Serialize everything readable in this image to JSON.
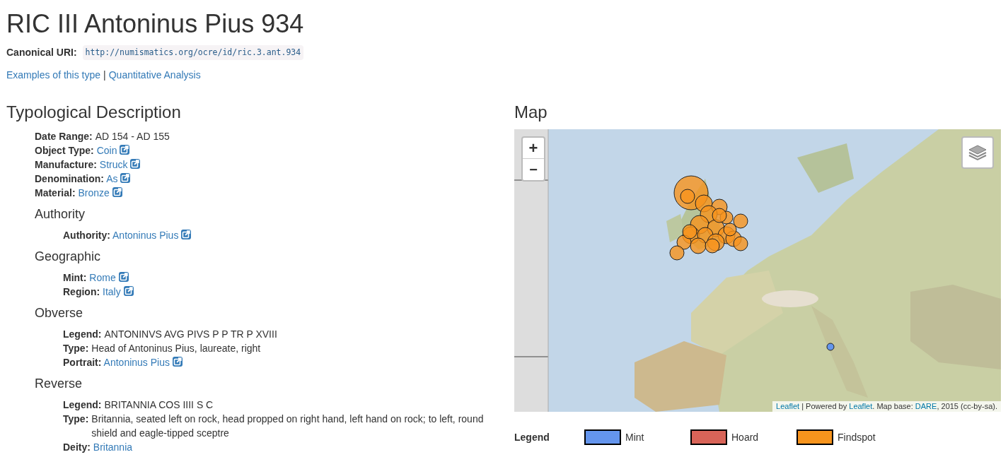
{
  "title": "RIC III Antoninus Pius 934",
  "canonical": {
    "label": "Canonical URI:",
    "uri": "http://numismatics.org/ocre/id/ric.3.ant.934"
  },
  "links": [
    {
      "label": "Examples of this type"
    },
    {
      "label": "Quantitative Analysis"
    }
  ],
  "link_separator": "|",
  "description": {
    "heading": "Typological Description",
    "fields": [
      {
        "label": "Date Range:",
        "value": "AD 154 - AD 155",
        "kind": "text"
      },
      {
        "label": "Object Type:",
        "value": "Coin",
        "kind": "external"
      },
      {
        "label": "Manufacture:",
        "value": "Struck",
        "kind": "external"
      },
      {
        "label": "Denomination:",
        "value": "As",
        "kind": "external"
      },
      {
        "label": "Material:",
        "value": "Bronze",
        "kind": "external"
      }
    ],
    "sections": [
      {
        "heading": "Authority",
        "fields": [
          {
            "label": "Authority:",
            "value": "Antoninus Pius",
            "kind": "external"
          }
        ]
      },
      {
        "heading": "Geographic",
        "fields": [
          {
            "label": "Mint:",
            "value": "Rome",
            "kind": "external"
          },
          {
            "label": "Region:",
            "value": "Italy",
            "kind": "external"
          }
        ]
      },
      {
        "heading": "Obverse",
        "fields": [
          {
            "label": "Legend:",
            "value": "ANTONINVS AVG PIVS P P TR P XVIII",
            "kind": "text"
          },
          {
            "label": "Type:",
            "value": "Head of Antoninus Pius, laureate, right",
            "kind": "text"
          },
          {
            "label": "Portrait:",
            "value": "Antoninus Pius",
            "kind": "external"
          }
        ]
      },
      {
        "heading": "Reverse",
        "fields": [
          {
            "label": "Legend:",
            "value": "BRITANNIA COS IIII S C",
            "kind": "text"
          },
          {
            "label": "Type:",
            "value": "Britannia, seated left on rock, head propped on right hand, left hand on rock; to left, round shield and eagle-tipped sceptre",
            "kind": "text"
          },
          {
            "label": "Deity:",
            "value": "Britannia",
            "kind": "link"
          }
        ]
      }
    ]
  },
  "map": {
    "heading": "Map",
    "zoom_in": "+",
    "zoom_out": "−",
    "attribution": [
      {
        "text": "Leaflet",
        "kind": "link"
      },
      {
        "text": " | Powered by ",
        "kind": "text"
      },
      {
        "text": "Leaflet",
        "kind": "link"
      },
      {
        "text": ". Map base: ",
        "kind": "text"
      },
      {
        "text": "DARE",
        "kind": "link"
      },
      {
        "text": ", 2015 (cc-by-sa).",
        "kind": "text"
      }
    ],
    "legend": {
      "label": "Legend",
      "items": [
        {
          "label": "Mint",
          "color": "#6495ed"
        },
        {
          "label": "Hoard",
          "color": "#d86458"
        },
        {
          "label": "Findspot",
          "color": "#f7941d"
        }
      ]
    }
  }
}
